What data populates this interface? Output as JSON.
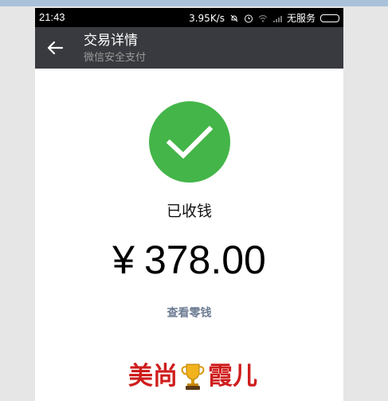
{
  "status_bar": {
    "time": "21:43",
    "network_speed": "3.95K/s",
    "service": "无服务",
    "icons": [
      "alarm-off-icon",
      "clock-icon",
      "wifi-icon",
      "signal-icon",
      "battery-icon"
    ]
  },
  "app_bar": {
    "title": "交易详情",
    "subtitle": "微信安全支付",
    "back_icon": "arrow-left-icon"
  },
  "transaction": {
    "status_icon": "check-circle-icon",
    "status_text": "已收钱",
    "currency_symbol": "¥",
    "amount": "378.00",
    "link_text": "查看零钱"
  },
  "signature": {
    "part1": "美尚",
    "part2": "霞儿",
    "icon": "trophy-icon"
  },
  "colors": {
    "app_bar": "#393a3f",
    "success": "#44b549",
    "link": "#6d7c93",
    "signature": "#cf1d1d"
  }
}
